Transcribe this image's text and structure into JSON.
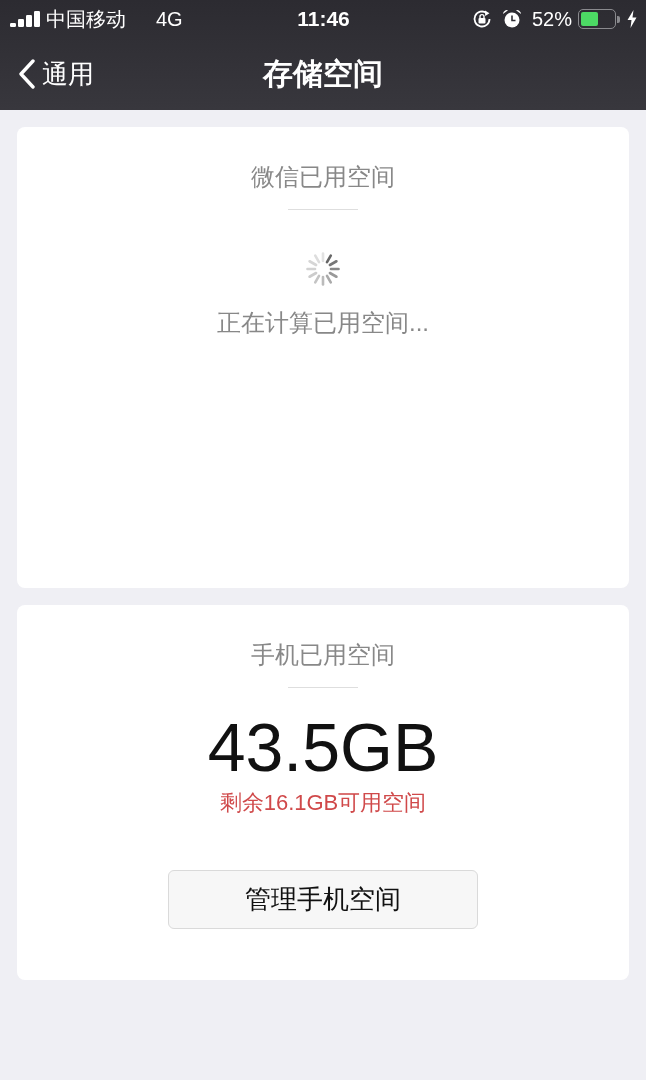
{
  "status_bar": {
    "carrier": "中国移动",
    "network": "4G",
    "time": "11:46",
    "battery_percent": "52%",
    "battery": {
      "level": 0.52
    },
    "charging": true
  },
  "nav_bar": {
    "back_label": "通用",
    "title": "存储空间"
  },
  "cards": [
    {
      "kind": "loading",
      "title": "微信已用空间",
      "message": "正在计算已用空间..."
    },
    {
      "kind": "usage",
      "title": "手机已用空间",
      "value": "43.5GB",
      "remaining": "剩余16.1GB可用空间",
      "button": "管理手机空间"
    }
  ]
}
